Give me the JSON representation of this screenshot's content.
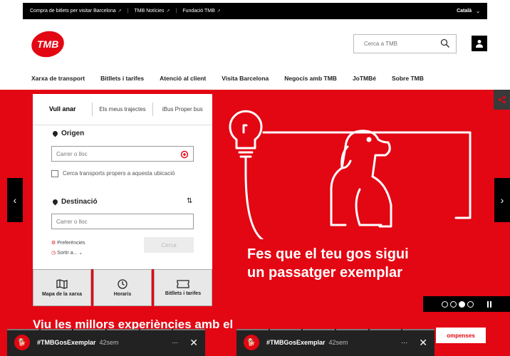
{
  "topbar": {
    "links": [
      "Compra de bitlets per visitar Barcelona",
      "TMB Notícies",
      "Fundació TMB"
    ],
    "language": "Català"
  },
  "header": {
    "logo_text": "TMB",
    "search_placeholder": "Cerca a TMB"
  },
  "nav": {
    "items": [
      "Xarxa de transport",
      "Bitllets i tarifes",
      "Atenció al client",
      "Visita Barcelona",
      "Negocis amb TMB",
      "JoTMBé",
      "Sobre TMB"
    ]
  },
  "planner": {
    "tabs": [
      {
        "label": "Vull anar"
      },
      {
        "label": "Els meus trajectes"
      },
      {
        "label": "iBus Proper bus"
      }
    ],
    "origin_label": "Origen",
    "origin_placeholder": "Carrer o lloc",
    "nearby_label": "Cerca transports propers a aquesta ubicació",
    "destination_label": "Destinació",
    "destination_placeholder": "Carrer o lloc",
    "preferences_label": "Preferències",
    "depart_label": "Sortir a...",
    "search_button": "Cerca"
  },
  "quick_links": [
    {
      "label": "Mapa de la xarxa",
      "icon": "map-icon"
    },
    {
      "label": "Horaris",
      "icon": "clock-icon"
    },
    {
      "label": "Bitllets i tarifes",
      "icon": "ticket-icon"
    }
  ],
  "hero": {
    "title_line1": "Fes que el teu gos sigui",
    "title_line2": "un passatger exemplar",
    "slide_count": 4,
    "active_slide": 3
  },
  "promo": {
    "title": "Viu les millors experiències amb el",
    "button": "ompenses"
  },
  "stories": [
    {
      "tag": "#TMBGosExemplar",
      "time": "42sem"
    },
    {
      "tag": "#TMBGosExemplar",
      "time": "42sem"
    }
  ],
  "colors": {
    "brand": "#e30613",
    "dark": "#000000"
  }
}
